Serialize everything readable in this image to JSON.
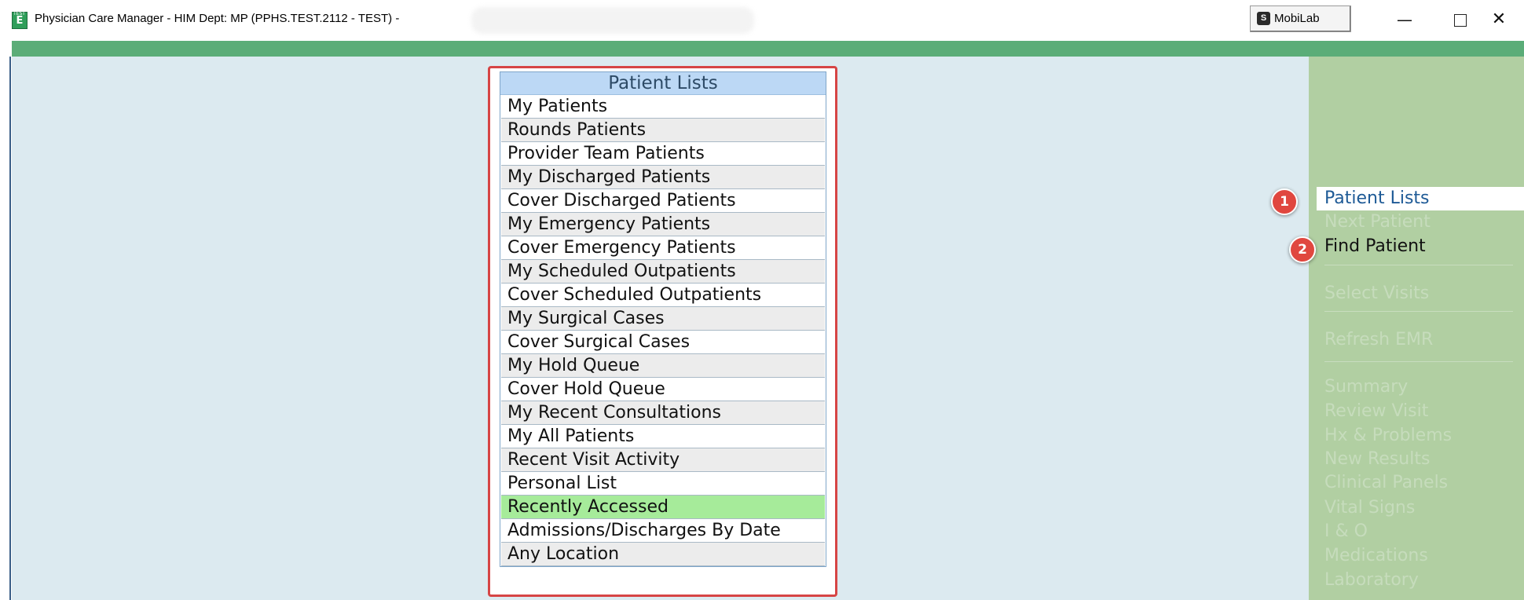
{
  "window": {
    "title": "Physician Care Manager - HIM Dept: MP (PPHS.TEST.2112 - TEST) -",
    "app_icon_label": "E",
    "app_icon_tag": "TEST",
    "taskbar_button": "MobiLab",
    "taskbar_icon": "S",
    "min_glyph": "—",
    "close_glyph": "✕"
  },
  "colors": {
    "header_green": "#5bad78",
    "main_bg": "#dceaf0",
    "side_panel": "#b1cfa2",
    "highlight_row": "#a6eb9a",
    "annotation_red": "#d64545"
  },
  "patient_lists": {
    "header": "Patient Lists",
    "items": [
      "My Patients",
      "Rounds Patients",
      "Provider Team Patients",
      "My Discharged Patients",
      "Cover Discharged Patients",
      "My Emergency Patients",
      "Cover Emergency Patients",
      "My Scheduled Outpatients",
      "Cover Scheduled Outpatients",
      "My Surgical Cases",
      "Cover Surgical Cases",
      "My Hold Queue",
      "Cover Hold Queue",
      "My Recent Consultations",
      "My All Patients",
      "Recent Visit Activity",
      "Personal List",
      "Recently Accessed",
      "Admissions/Discharges By Date",
      "Any Location"
    ],
    "selected": "Recently Accessed"
  },
  "side_menu": {
    "patient_lists": "Patient Lists",
    "next_patient": "Next Patient",
    "find_patient": "Find Patient",
    "select_visits": "Select Visits",
    "refresh_emr": "Refresh EMR",
    "summary": "Summary",
    "review_visit": "Review Visit",
    "hx_problems": "Hx & Problems",
    "new_results": "New Results",
    "clinical_panels": "Clinical Panels",
    "vital_signs": "Vital Signs",
    "i_o": "I & O",
    "medications": "Medications",
    "laboratory": "Laboratory"
  },
  "annotations": {
    "step1": "1",
    "step2": "2"
  }
}
